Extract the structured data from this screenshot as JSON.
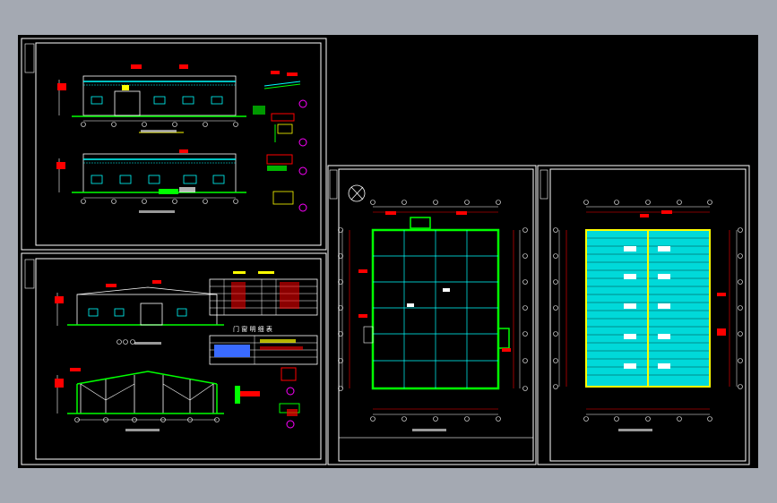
{
  "app": {
    "background_color": "#a4a9b2",
    "canvas_color": "#000000"
  },
  "sheets": [
    {
      "id": "elevations",
      "title": "",
      "frame_color": "#ffffff"
    },
    {
      "id": "section-and-schedules",
      "title": "",
      "frame_color": "#ffffff",
      "schedule_titles": [
        "",
        "门 窗 明 细 表"
      ]
    },
    {
      "id": "floor-plan",
      "title": "",
      "frame_color": "#ffffff"
    },
    {
      "id": "roof-plan",
      "title": "",
      "frame_color": "#ffffff"
    }
  ],
  "layer_colors": {
    "frame": "#ffffff",
    "walls": "#00ff00",
    "grid": "#00ffff",
    "dimensions": "#ff0000",
    "text": "#ffff00",
    "hatch": "#3a6bff",
    "annotation": "#ff00ff"
  },
  "icons": [
    "north-arrow-icon",
    "grid-bubble-icon"
  ]
}
